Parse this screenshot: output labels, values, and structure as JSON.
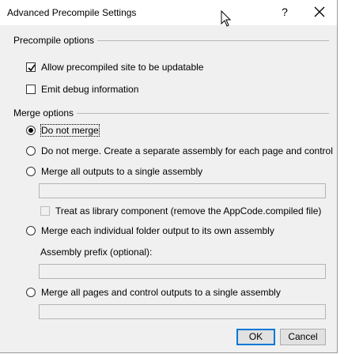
{
  "window": {
    "title": "Advanced Precompile Settings",
    "help_glyph": "?"
  },
  "precompile": {
    "group_label": "Precompile options",
    "allow_updatable": {
      "label": "Allow precompiled site to be updatable",
      "checked": true
    },
    "emit_debug": {
      "label": "Emit debug information",
      "checked": false
    }
  },
  "merge": {
    "group_label": "Merge options",
    "options": [
      {
        "label": "Do not merge",
        "selected": true
      },
      {
        "label": "Do not merge. Create a separate assembly for each page and control",
        "selected": false
      },
      {
        "label": "Merge all outputs to a single assembly",
        "selected": false
      },
      {
        "label": "Merge each individual folder output to its own assembly",
        "selected": false
      },
      {
        "label": "Merge all pages and control outputs to a single assembly",
        "selected": false
      }
    ],
    "single_assembly_value": "",
    "treat_as_library": {
      "label": "Treat as library component (remove the AppCode.compiled file)",
      "checked": false
    },
    "assembly_prefix_label": "Assembly prefix (optional):",
    "assembly_prefix_value": "",
    "pages_assembly_value": ""
  },
  "buttons": {
    "ok": "OK",
    "cancel": "Cancel"
  }
}
